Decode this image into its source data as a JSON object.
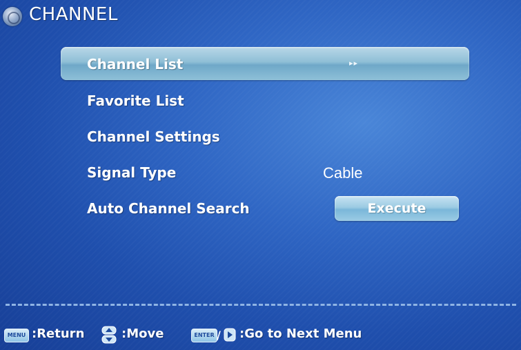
{
  "header": {
    "title": "CHANNEL",
    "icon": "channel-globe-icon"
  },
  "menu": {
    "selected_index": 0,
    "items": [
      {
        "label": "Channel List",
        "indicator": "▸▸"
      },
      {
        "label": "Favorite List"
      },
      {
        "label": "Channel Settings"
      },
      {
        "label": "Signal Type",
        "value": "Cable"
      },
      {
        "label": "Auto Channel Search",
        "button": "Execute"
      }
    ]
  },
  "footer": {
    "menu_key": "MENU",
    "return_label": ":Return",
    "move_label": ":Move",
    "enter_key": "ENTER",
    "next_label": ":Go to Next Menu"
  },
  "colors": {
    "background": "#2f66c4",
    "highlight": "#8fbfd6",
    "divider": "#8fb4e4"
  }
}
